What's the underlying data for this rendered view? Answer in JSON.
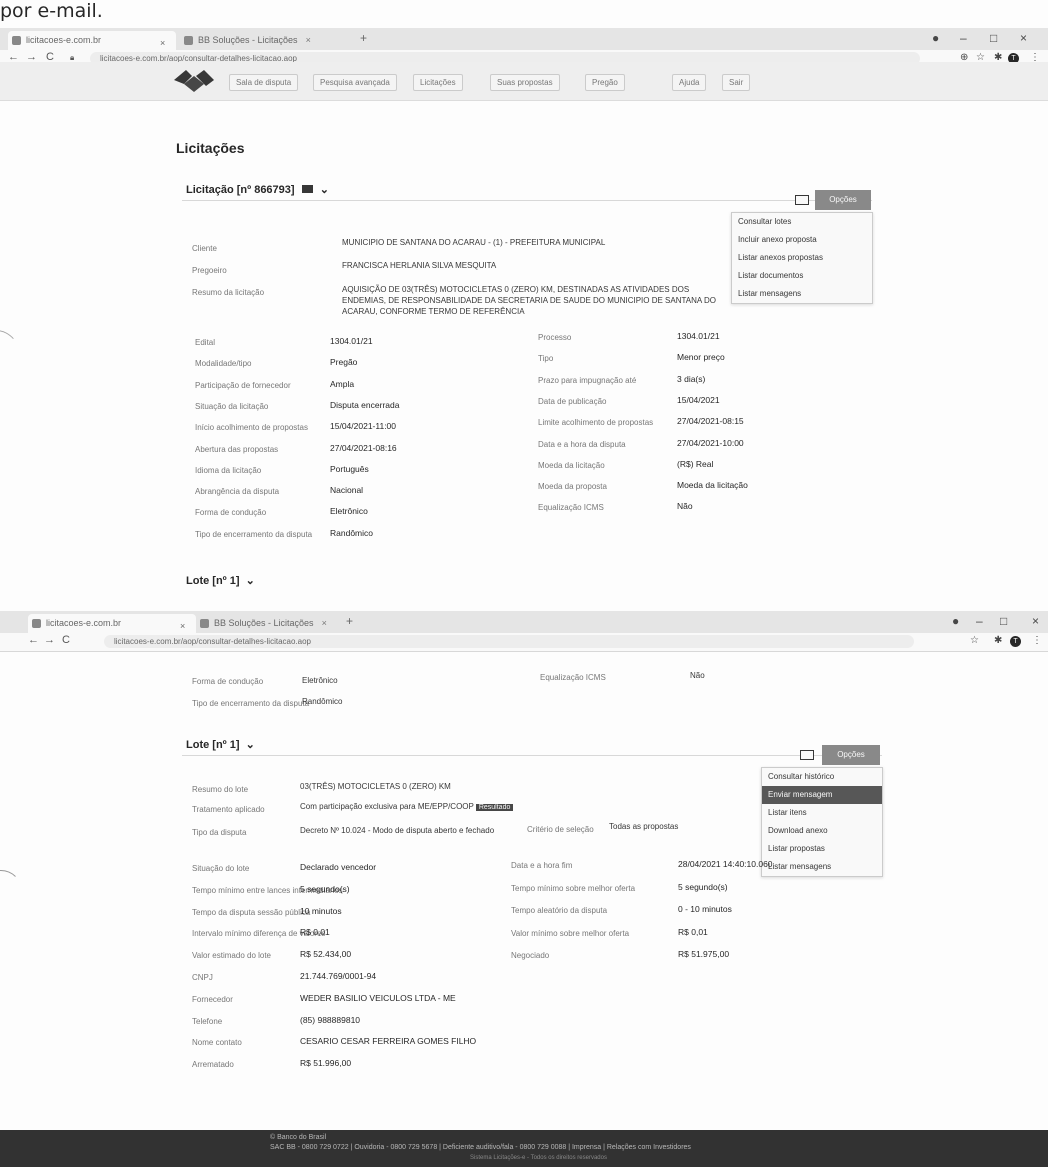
{
  "caption": "por e-mail.",
  "browser": {
    "tab1": "licitacoes-e.com.br",
    "tab2": "BB Soluções - Licitações",
    "new_tab": "+",
    "url": "licitacoes-e.com.br/aop/consultar-detalhes-licitacao.aop",
    "min": "–",
    "max": "□",
    "close": "×"
  },
  "sitenav": {
    "items": [
      "Sala de disputa",
      "Pesquisa avançada",
      "Licitações",
      "Suas propostas",
      "Pregão",
      "Ajuda",
      "Sair"
    ]
  },
  "page": {
    "title": "Licitações",
    "licitacao_header": "Licitação [nº 866793]",
    "opcoes": "Opções",
    "menu1": [
      "Consultar lotes",
      "Incluir anexo proposta",
      "Listar anexos propostas",
      "Listar documentos",
      "Listar mensagens"
    ],
    "fields_top": [
      {
        "label": "Cliente",
        "value": "MUNICIPIO DE SANTANA DO ACARAU - (1) - PREFEITURA MUNICIPAL"
      },
      {
        "label": "Pregoeiro",
        "value": "FRANCISCA HERLANIA SILVA MESQUITA"
      },
      {
        "label": "Resumo da licitação",
        "value": "AQUISIÇÃO DE 03(TRÊS) MOTOCICLETAS 0 (ZERO) KM, DESTINADAS AS ATIVIDADES DOS ENDEMIAS, DE RESPONSABILIDADE DA SECRETARIA DE SAUDE DO MUNICIPIO DE SANTANA DO ACARAU, CONFORME TERMO DE REFERÊNCIA"
      }
    ],
    "fields_left": [
      {
        "label": "Edital",
        "value": "1304.01/21"
      },
      {
        "label": "Modalidade/tipo",
        "value": "Pregão"
      },
      {
        "label": "Participação de fornecedor",
        "value": "Ampla"
      },
      {
        "label": "Situação da licitação",
        "value": "Disputa encerrada"
      },
      {
        "label": "Início acolhimento de propostas",
        "value": "15/04/2021-11:00"
      },
      {
        "label": "Abertura das propostas",
        "value": "27/04/2021-08:16"
      },
      {
        "label": "Idioma da licitação",
        "value": "Português"
      },
      {
        "label": "Abrangência da disputa",
        "value": "Nacional"
      },
      {
        "label": "Forma de condução",
        "value": "Eletrônico"
      },
      {
        "label": "Tipo de encerramento da disputa",
        "value": "Randômico"
      }
    ],
    "fields_right": [
      {
        "label": "Processo",
        "value": "1304.01/21"
      },
      {
        "label": "Tipo",
        "value": "Menor preço"
      },
      {
        "label": "Prazo para impugnação até",
        "value": "3 dia(s)"
      },
      {
        "label": "Data de publicação",
        "value": "15/04/2021"
      },
      {
        "label": "Limite acolhimento de propostas",
        "value": "27/04/2021-08:15"
      },
      {
        "label": "Data e a hora da disputa",
        "value": "27/04/2021-10:00"
      },
      {
        "label": "Moeda da licitação",
        "value": "(R$) Real"
      },
      {
        "label": "Moeda da proposta",
        "value": "Moeda da licitação"
      },
      {
        "label": "Equalização ICMS",
        "value": "Não"
      }
    ],
    "lote_header": "Lote [nº 1]",
    "lote_chevron": "⌄"
  },
  "page2": {
    "carry": [
      {
        "label": "Forma de condução",
        "value": "Eletrônico"
      },
      {
        "label": "Tipo de encerramento da disputa",
        "value": "Randômico"
      }
    ],
    "carry_right": {
      "label": "Equalização ICMS",
      "value": "Não"
    },
    "lote_header": "Lote [nº 1]",
    "opcoes": "Opções",
    "menu2": [
      "Consultar histórico",
      "Enviar mensagem",
      "Listar itens",
      "Download anexo",
      "Listar propostas",
      "Listar mensagens"
    ],
    "menu2_highlight": 1,
    "lote_fields_top": [
      {
        "label": "Resumo do lote",
        "value": "03(TRÊS) MOTOCICLETAS 0 (ZERO) KM"
      },
      {
        "label": "Tratamento aplicado",
        "value": "Com participação exclusiva para ME/EPP/COOP",
        "badge": "Resultado"
      }
    ],
    "tipo_disputa": {
      "label": "Tipo da disputa",
      "value": "Decreto Nº 10.024 - Modo de disputa aberto e fechado"
    },
    "criterio": {
      "label": "Critério de seleção",
      "value": "Todas as propostas"
    },
    "left": [
      {
        "label": "Situação do lote",
        "value": "Declarado vencedor"
      },
      {
        "label": "Tempo mínimo entre lances intermediários",
        "value": "5 segundo(s)"
      },
      {
        "label": "Tempo da disputa sessão pública",
        "value": "10 minutos"
      },
      {
        "label": "Intervalo mínimo diferença de valores",
        "value": "R$ 0,01"
      },
      {
        "label": "Valor estimado do lote",
        "value": "R$ 52.434,00"
      },
      {
        "label": "CNPJ",
        "value": "21.744.769/0001-94"
      },
      {
        "label": "Fornecedor",
        "value": "WEDER BASILIO VEICULOS LTDA - ME"
      },
      {
        "label": "Telefone",
        "value": "(85) 988889810"
      },
      {
        "label": "Nome contato",
        "value": "CESARIO CESAR FERREIRA GOMES FILHO"
      },
      {
        "label": "Arrematado",
        "value": "R$ 51.996,00"
      }
    ],
    "right": [
      {
        "label": "Data e a hora fim",
        "value": "28/04/2021 14:40:10.060"
      },
      {
        "label": "Tempo mínimo sobre melhor oferta",
        "value": "5 segundo(s)"
      },
      {
        "label": "Tempo aleatório da disputa",
        "value": "0 - 10 minutos"
      },
      {
        "label": "Valor mínimo sobre melhor oferta",
        "value": "R$ 0,01"
      },
      {
        "label": "Negociado",
        "value": "R$ 51.975,00"
      }
    ]
  },
  "footer": {
    "line1": "© Banco do Brasil",
    "line2": "SAC BB - 0800 729 0722   |   Ouvidoria - 0800 729 5678   |   Deficiente auditivo/fala - 0800 729 0088   |   Imprensa   |   Relações com Investidores",
    "line3": "Sistema Licitações-e - Todos os direitos reservados"
  }
}
